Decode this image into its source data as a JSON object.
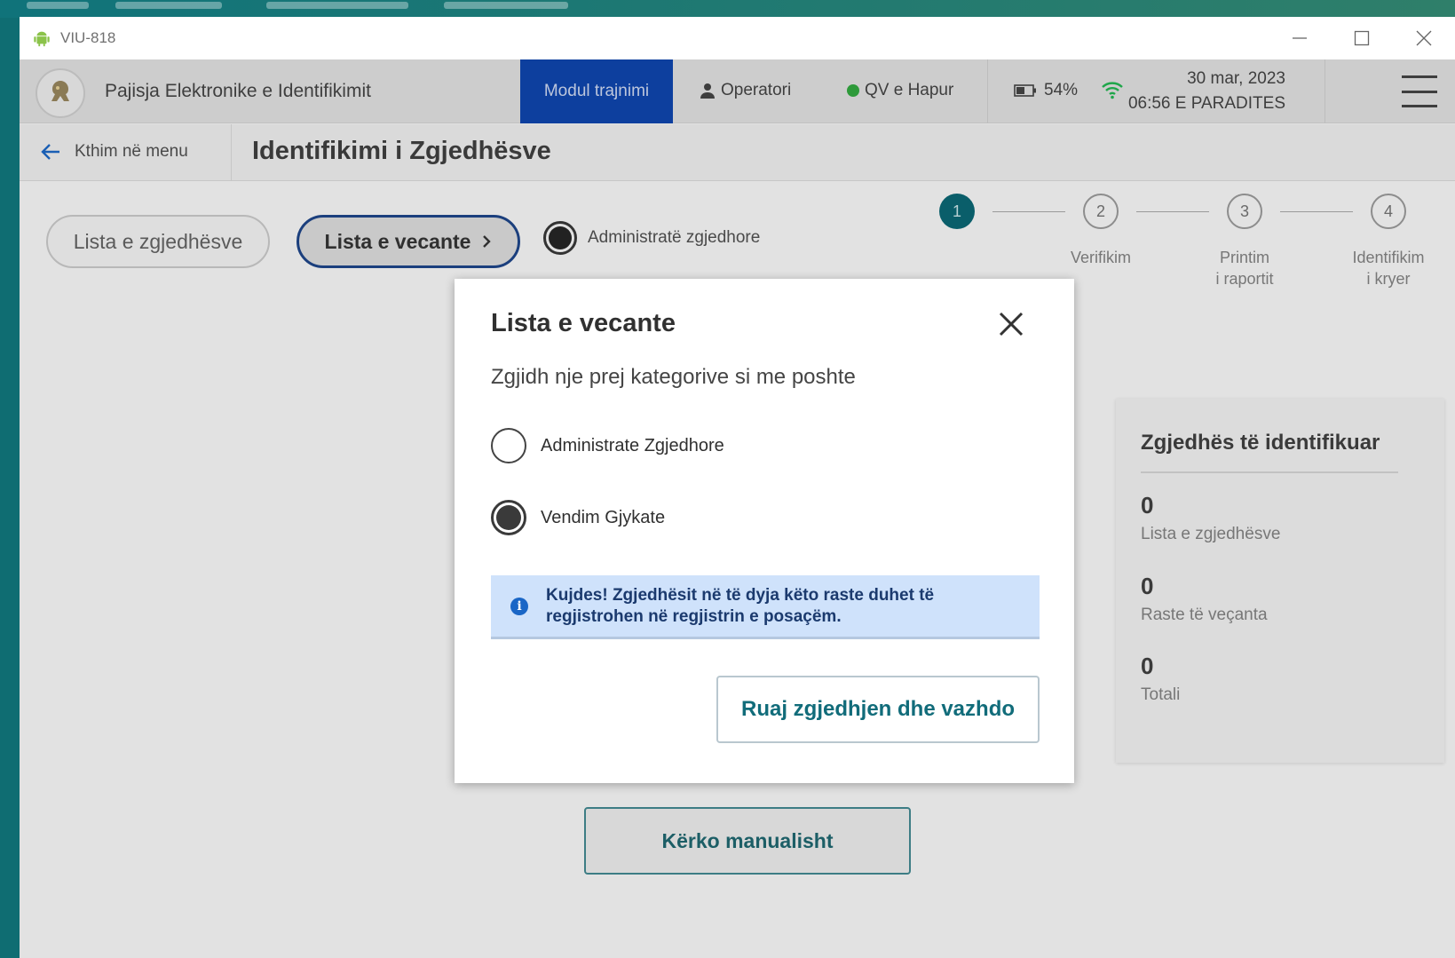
{
  "window": {
    "title": "VIU-818",
    "controls": {
      "minimize": "—",
      "maximize": "☐",
      "close": "✕"
    }
  },
  "appbar": {
    "app_name": "Pajisja Elektronike e Identifikimit",
    "training_mode": "Modul trajnimi",
    "operator": "Operatori",
    "station_status": "QV e Hapur",
    "battery": "54%",
    "date": "30 mar, 2023",
    "time": "06:56 E PARADITES",
    "colors": {
      "active_tab": "#0d3f9e",
      "status_green": "#2e9a3a",
      "wifi": "#1fa64a"
    }
  },
  "subbar": {
    "back_label": "Kthim në menu",
    "page_title": "Identifikimi i Zgjedhësve"
  },
  "tabs": {
    "voter_list": "Lista e zgjedhësve",
    "special_list": "Lista e vecante",
    "admin_option": "Administratë zgjedhore"
  },
  "steps": [
    {
      "number": "1",
      "label": "",
      "active": true
    },
    {
      "number": "2",
      "label": "Verifikim",
      "active": false
    },
    {
      "number": "3",
      "label_line1": "Printim",
      "label_line2": "i raportit",
      "active": false
    },
    {
      "number": "4",
      "label_line1": "Identifikim",
      "label_line2": "i kryer",
      "active": false
    }
  ],
  "stats": {
    "title": "Zgjedhës të identifikuar",
    "items": [
      {
        "value": "0",
        "label": "Lista e zgjedhësve"
      },
      {
        "value": "0",
        "label": "Raste të veçanta"
      },
      {
        "value": "0",
        "label": "Totali"
      }
    ]
  },
  "search_manual": "Kërko manualisht",
  "modal": {
    "title": "Lista e vecante",
    "subtitle": "Zgjidh nje prej kategorive si me poshte",
    "options": [
      {
        "label": "Administrate Zgjedhore",
        "selected": false
      },
      {
        "label": "Vendim Gjykate",
        "selected": true
      }
    ],
    "alert_line1": "Kujdes! Zgjedhësit në të dyja këto raste duhet të",
    "alert_line2": "regjistrohen në regjistrin e posaçëm.",
    "save_button": "Ruaj zgjedhjen dhe vazhdo"
  }
}
